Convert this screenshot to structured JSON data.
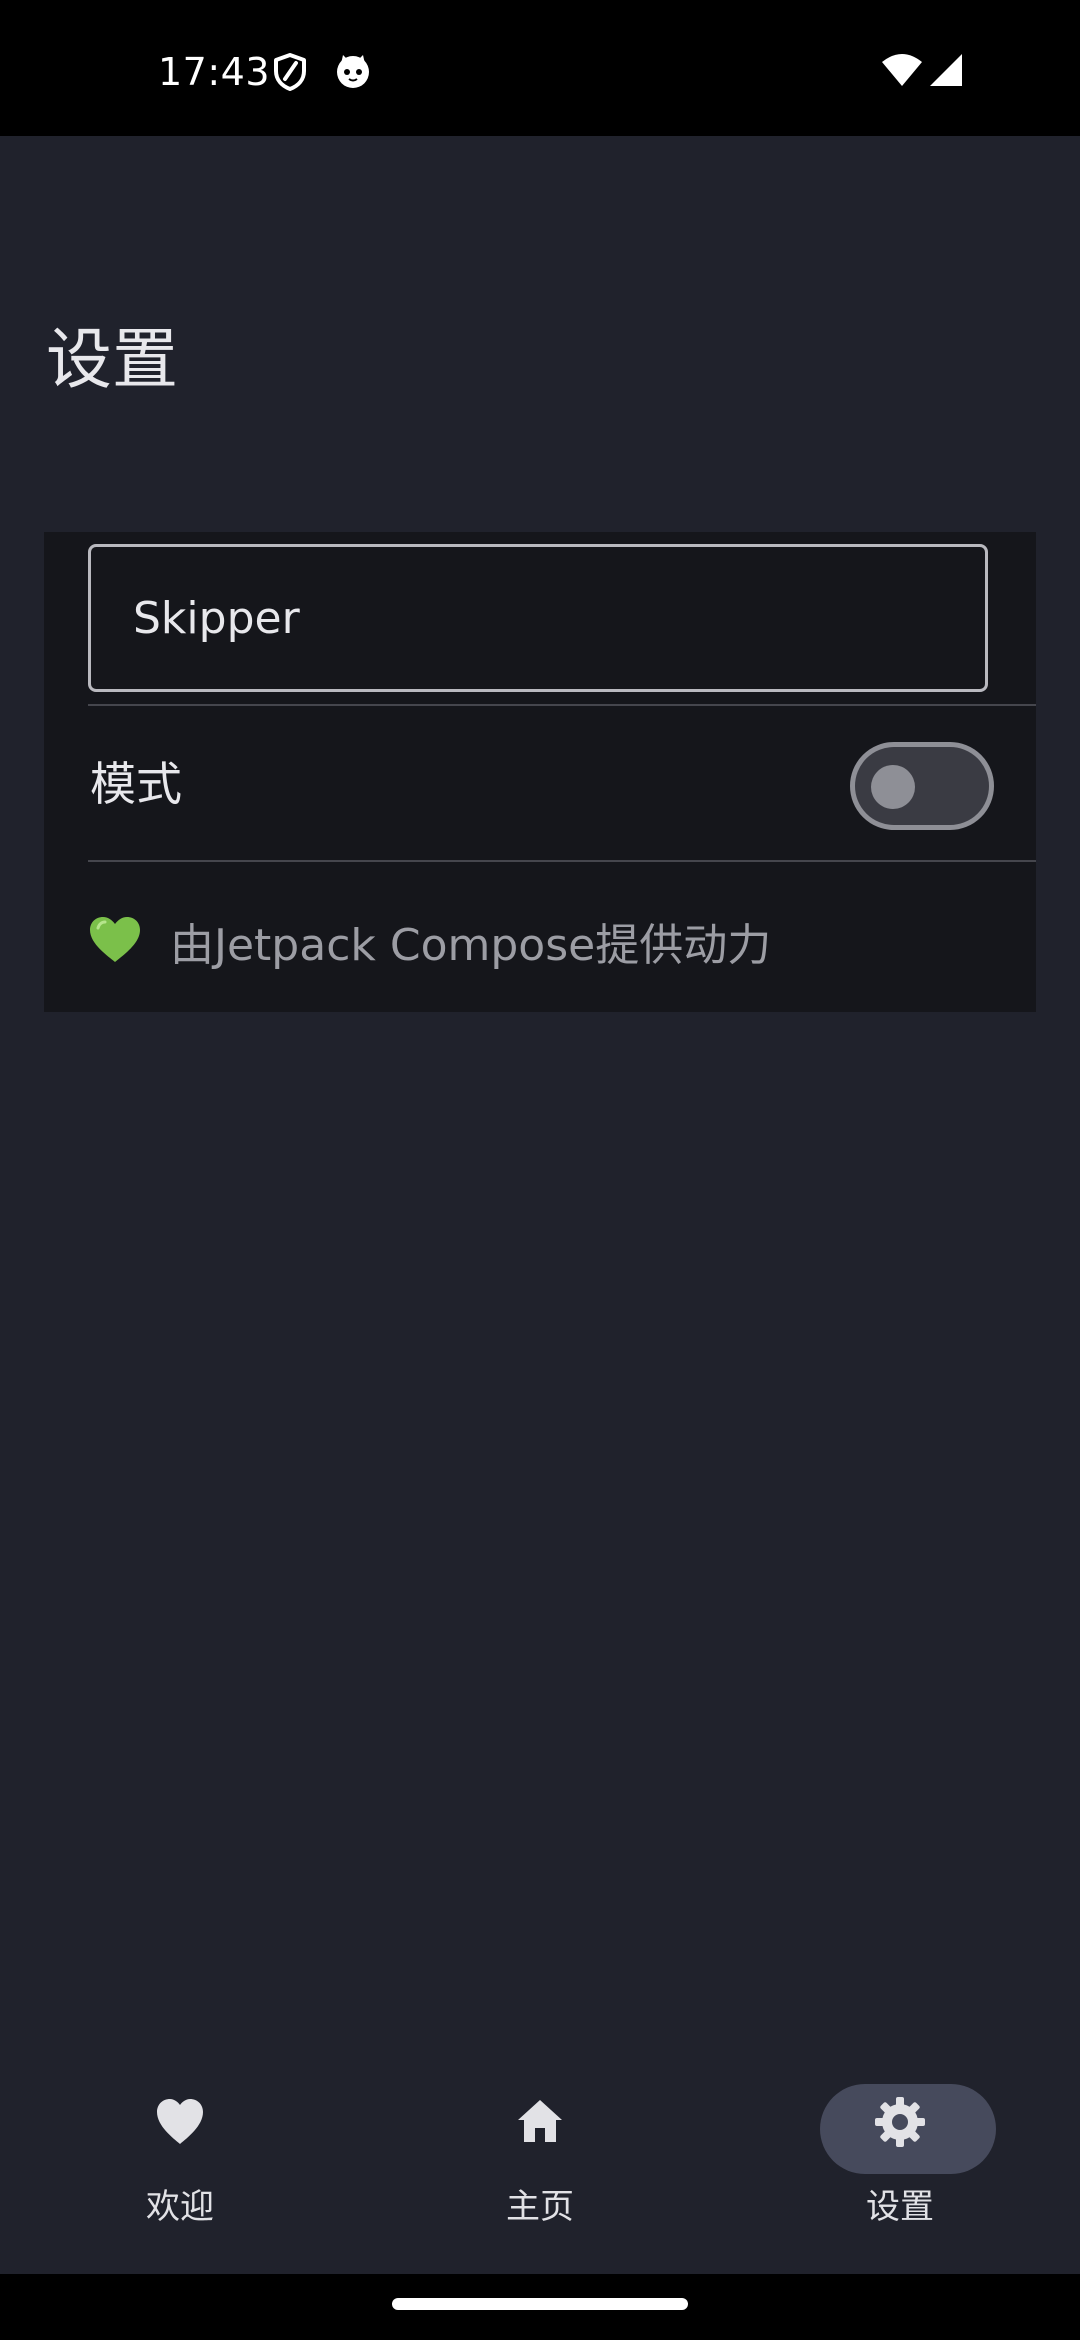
{
  "status_bar": {
    "time": "17:43",
    "icons": [
      "shield-icon",
      "cat-face-icon",
      "wifi-icon",
      "cellular-signal-icon"
    ]
  },
  "page": {
    "title": "设置"
  },
  "settings": {
    "name_field_value": "Skipper",
    "mode_label": "模式",
    "mode_enabled": false,
    "powered_by_icon": "green-heart-icon",
    "powered_by_text": "由Jetpack Compose提供动力"
  },
  "bottom_nav": {
    "items": [
      {
        "label": "欢迎",
        "icon": "heart-icon",
        "selected": false
      },
      {
        "label": "主页",
        "icon": "home-icon",
        "selected": false
      },
      {
        "label": "设置",
        "icon": "gear-icon",
        "selected": true
      }
    ]
  },
  "colors": {
    "background": "#20222c",
    "card": "#15161b",
    "nav_indicator": "#464a5c",
    "heart_green": "#7bc04a"
  }
}
